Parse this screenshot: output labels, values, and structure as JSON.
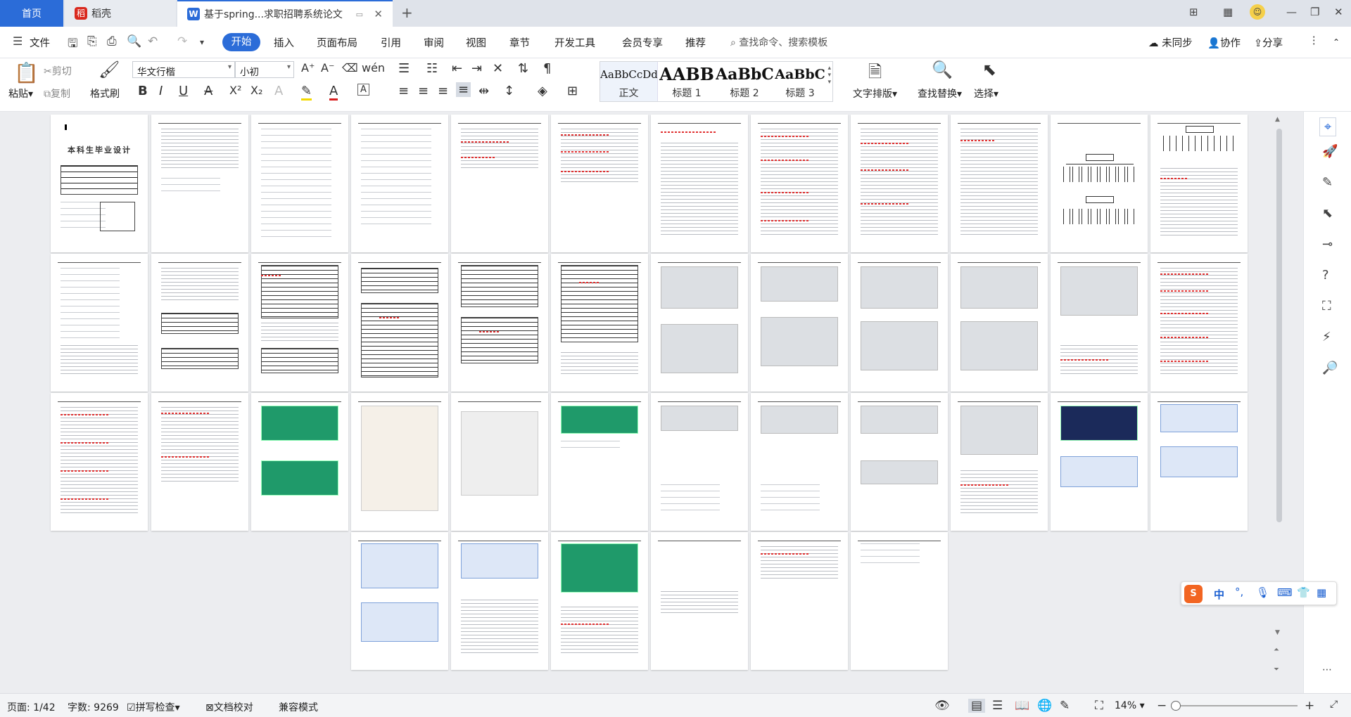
{
  "tabs": {
    "home": "首页",
    "daoke": "稻壳",
    "doc": "基于spring...求职招聘系统论文"
  },
  "menubar": {
    "file": "文件",
    "items": [
      "开始",
      "插入",
      "页面布局",
      "引用",
      "审阅",
      "视图",
      "章节",
      "开发工具",
      "会员专享",
      "推荐"
    ],
    "search": "查找命令、搜索模板",
    "sync": "未同步",
    "collab": "协作",
    "share": "分享"
  },
  "ribbon": {
    "paste": "粘贴",
    "cut": "剪切",
    "copy": "复制",
    "format_painter": "格式刷",
    "font": "华文行楷",
    "size": "小初",
    "bold": "B",
    "italic": "I",
    "underline": "U",
    "sup": "X²",
    "sub": "X₂",
    "styles": [
      {
        "sample": "AaBbCcDd",
        "label": "正文"
      },
      {
        "sample": "AABB",
        "label": "标题 1"
      },
      {
        "sample": "AaBbC",
        "label": "标题 2"
      },
      {
        "sample": "AaBbC",
        "label": "标题 3"
      }
    ],
    "typeset": "文字排版",
    "findreplace": "查找替换",
    "select": "选择"
  },
  "status": {
    "page": "页面: 1/42",
    "words": "字数: 9269",
    "spell": "拼写检查",
    "proof": "文档校对",
    "compat": "兼容模式",
    "zoom": "14%"
  },
  "ime": {
    "mode": "中",
    "punct": "°,"
  },
  "cover": {
    "title": "本科生毕业设计"
  },
  "colors": {
    "accent": "#2b6cd8",
    "spell_error": "#e03030",
    "doc_bg": "#ecedf0"
  }
}
